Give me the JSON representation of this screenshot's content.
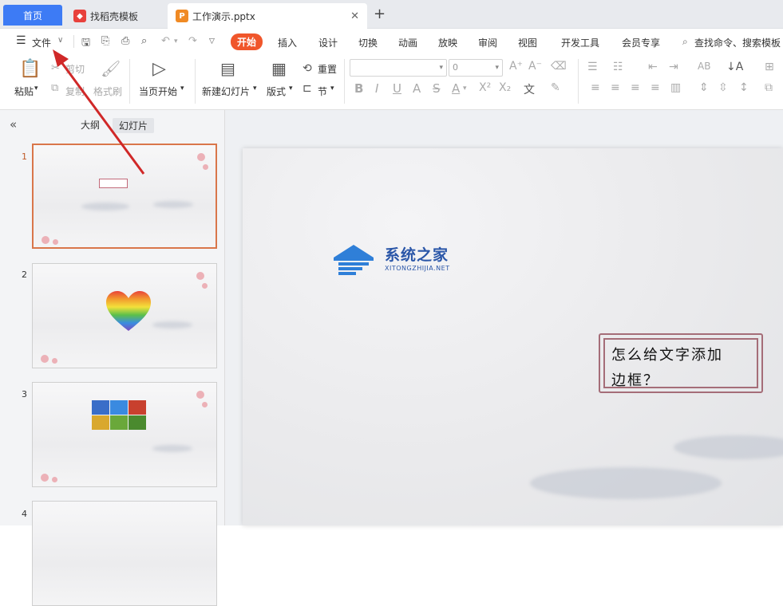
{
  "tabs": {
    "home": "首页",
    "template": "找稻壳模板",
    "document": "工作演示.pptx",
    "template_icon": "daoke-icon",
    "document_icon": "P"
  },
  "menu": {
    "file": "文件",
    "items": [
      "开始",
      "插入",
      "设计",
      "切换",
      "动画",
      "放映",
      "审阅",
      "视图",
      "开发工具",
      "会员专享"
    ],
    "search": "查找命令、搜索模板"
  },
  "ribbon": {
    "paste": "粘贴",
    "cut": "剪切",
    "copy": "复制",
    "format_painter": "格式刷",
    "play_from_start": "当页开始",
    "new_slide": "新建幻灯片",
    "layout": "版式",
    "reset": "重置",
    "section": "节",
    "font_size": "0"
  },
  "left_panel": {
    "outline_tab": "大纲",
    "slides_tab": "幻灯片",
    "slide_numbers": [
      "1",
      "2",
      "3",
      "4"
    ]
  },
  "slide": {
    "text_line1": "怎么给文字添加",
    "text_line2": "边框？"
  },
  "watermark": {
    "title": "系统之家",
    "subtitle": "XITONGZHIJIA.NET"
  },
  "colors": {
    "accent": "#f0562b",
    "home_tab": "#3d7bf5",
    "border": "#a56d78",
    "arrow": "#d02828",
    "selected_thumb": "#d9764a"
  }
}
